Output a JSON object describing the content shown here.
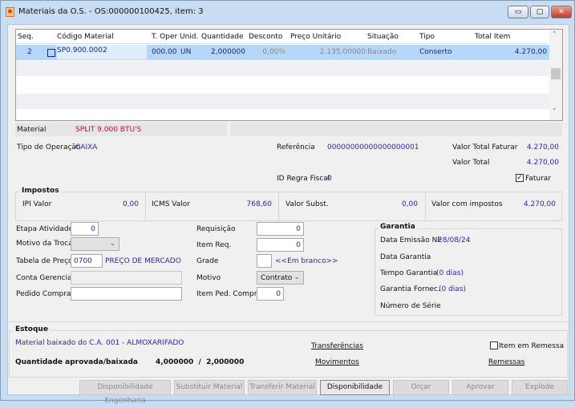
{
  "window": {
    "title": "Materiais da O.S. - OS:000000100425, item: 3",
    "minimize": "▭",
    "maximize": "▢",
    "close": "✕"
  },
  "grid": {
    "columns": [
      "Seq.",
      "Código Material",
      "T. Oper",
      "Unid.",
      "Quantidade",
      "Desconto",
      "Preço Unitário",
      "Situação",
      "Tipo",
      "Total Item"
    ],
    "rows": [
      {
        "seq": "2",
        "codigo": "SP0.900.0002",
        "toper": "000.00",
        "unid": "UN",
        "quantidade": "2,000000",
        "desconto": "0,00%",
        "preco": "2.135,00000",
        "situacao": "Baixado",
        "tipo": "Conserto",
        "total": "4.270,00"
      }
    ]
  },
  "material": {
    "label": "Material",
    "value": "SPLIT 9.000 BTU'S"
  },
  "info": {
    "tipo_op_label": "Tipo de Operação",
    "tipo_op": "CAIXA",
    "ref_label": "Referência",
    "ref": "00000000000000000001",
    "vtf_label": "Valor Total Faturar",
    "vtf": "4.270,00",
    "vt_label": "Valor Total",
    "vt": "4.270,00",
    "regra_label": "ID Regra Fiscal",
    "regra": "0",
    "faturar": "Faturar",
    "faturar_checked": true
  },
  "impostos": {
    "title": "Impostos",
    "ipi_label": "IPI Valor",
    "ipi": "0,00",
    "icms_label": "ICMS Valor",
    "icms": "768,60",
    "subst_label": "Valor Subst.",
    "subst": "0,00",
    "com_label": "Valor com impostos",
    "com": "4.270,00"
  },
  "form": {
    "etapa_label": "Etapa Atividade",
    "etapa": "0",
    "motivo_troca_label": "Motivo da Troca",
    "motivo_troca": "",
    "tabela_label": "Tabela de Preço",
    "tabela": "0700",
    "tabela_desc": "PREÇO DE MERCADO",
    "conta_label": "Conta Gerencial",
    "conta": "",
    "pedido_label": "Pedido Compra",
    "pedido": "",
    "requisicao_label": "Requisição",
    "requisicao": "0",
    "itemreq_label": "Item Req.",
    "itemreq": "0",
    "grade_label": "Grade",
    "grade": "",
    "grade_desc": "<<Em branco>>",
    "motivo_label": "Motivo",
    "motivo": "Contrato",
    "itemped_label": "Item Ped. Compra",
    "itemped": "0"
  },
  "garantia": {
    "title": "Garantia",
    "emissao_label": "Data Emissão NF",
    "emissao": "28/08/24",
    "data_label": "Data Garantia",
    "tempo_label": "Tempo Garantia",
    "tempo": "(0 dias)",
    "fornec_label": "Garantia Fornec.",
    "fornec": "(0 dias)",
    "serie_label": "Número de Série"
  },
  "estoque": {
    "title": "Estoque",
    "baixado": "Material baixado do C.A. 001  - ALMOXARIFADO",
    "qtd_label": "Quantidade aprovada/baixada",
    "qtd": "4,000000  /  2,000000",
    "transferencias": "Transferências",
    "movimentos": "Movimentos",
    "remessa_label": "Item em Remessa",
    "remessas": "Remessas"
  },
  "buttons": [
    "Disponibilidade Engenharia",
    "Substituir Material",
    "Transferir Material",
    "Disponibilidade",
    "Orçar",
    "Aprovar",
    "Explode"
  ]
}
